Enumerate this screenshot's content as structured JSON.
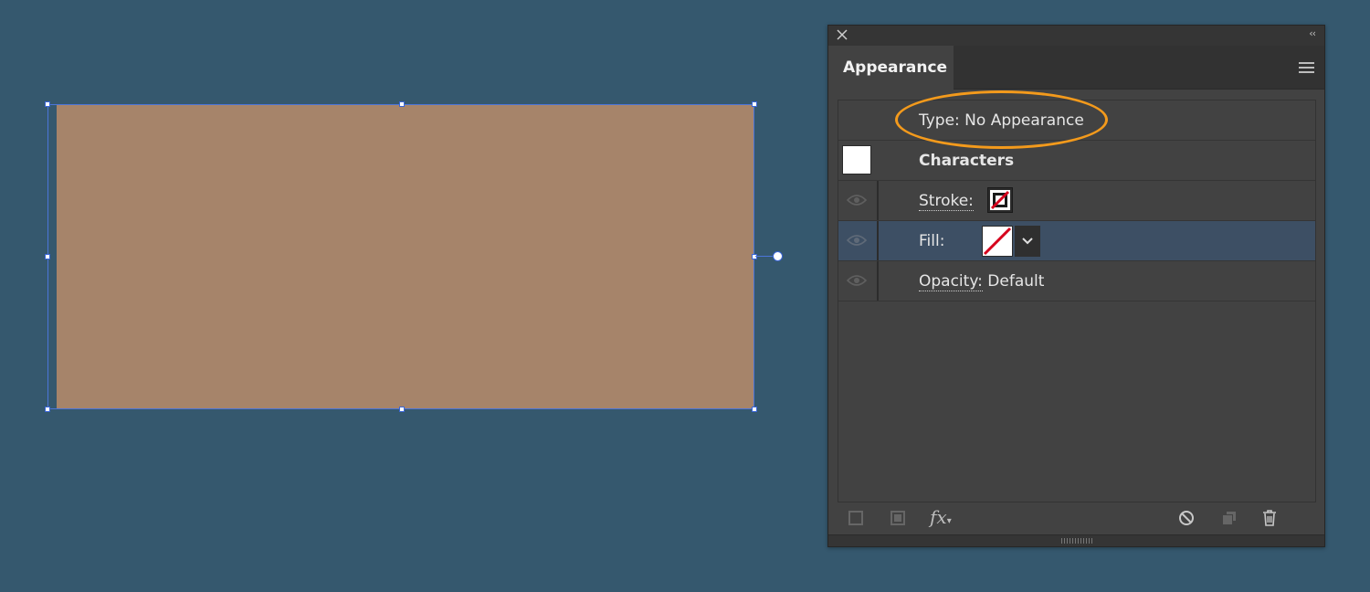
{
  "canvas": {
    "shape_fill": "#a6846a",
    "selection_color": "#4c75d9"
  },
  "panel": {
    "title": "Appearance",
    "collapse_glyph": "‹‹",
    "type_label": "Type: No Appearance",
    "rows": {
      "characters": "Characters",
      "stroke": "Stroke:",
      "fill": "Fill:",
      "opacity_label": "Opacity:",
      "opacity_value": "Default"
    },
    "fx_label": "fx",
    "annotation_color": "#f39a1c"
  }
}
